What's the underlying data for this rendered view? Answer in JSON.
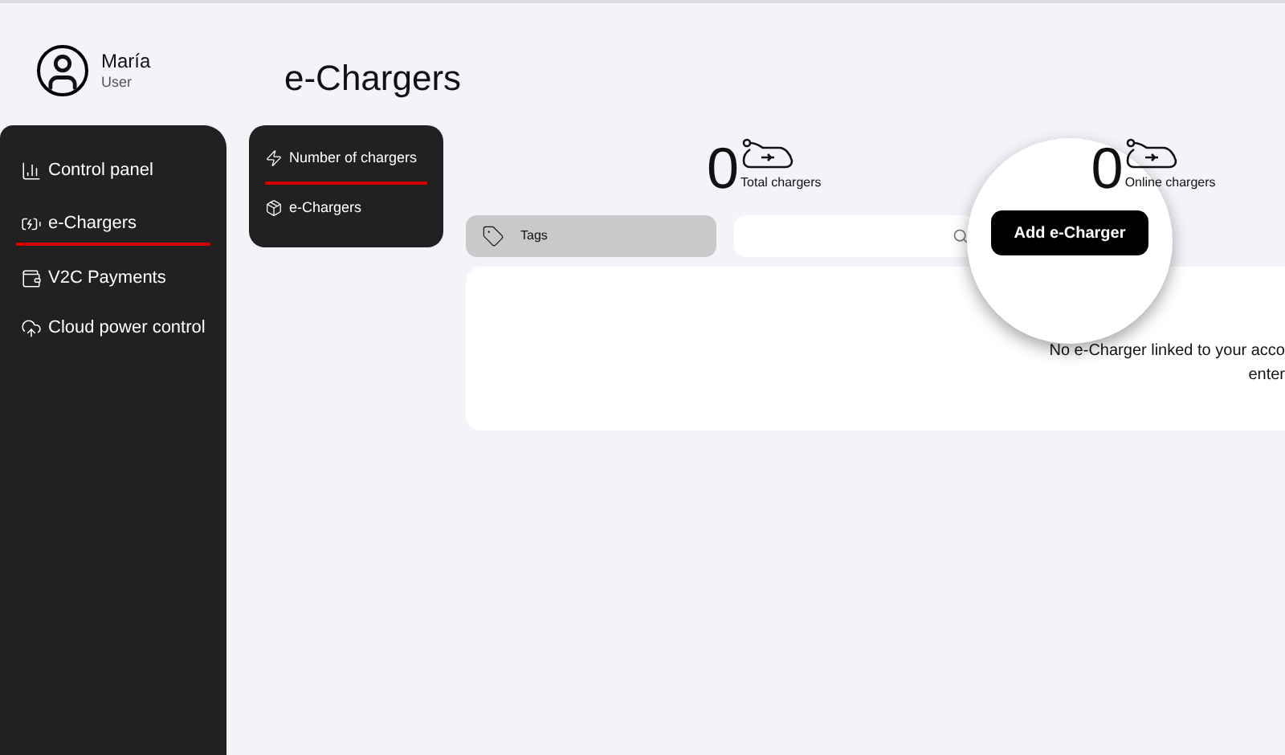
{
  "user": {
    "name": "María",
    "role": "User"
  },
  "page_title": "e-Chargers",
  "sidebar": {
    "items": [
      {
        "label": "Control panel",
        "selected": false
      },
      {
        "label": "e-Chargers",
        "selected": true
      },
      {
        "label": "V2C Payments",
        "selected": false
      },
      {
        "label": "Cloud power control",
        "selected": false
      }
    ]
  },
  "submenu": {
    "items": [
      {
        "label": "Number of chargers",
        "selected": true
      },
      {
        "label": "e-Chargers",
        "selected": false
      }
    ]
  },
  "stats": [
    {
      "value": "0",
      "label": "Total chargers"
    },
    {
      "value": "0",
      "label": "Online chargers"
    }
  ],
  "tags_button": "Tags",
  "add_button": "Add e-Charger",
  "empty_message": [
    "No e-Charger linked to your acco",
    "enter"
  ]
}
